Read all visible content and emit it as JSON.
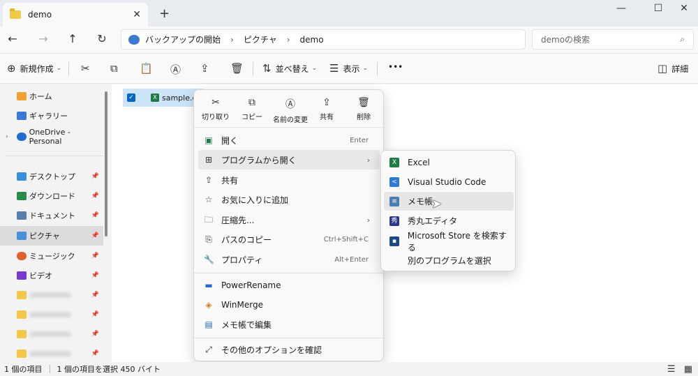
{
  "window": {
    "tab_title": "demo",
    "tab_close": "✕",
    "new_tab": "+",
    "minimize": "—",
    "maximize": "☐",
    "close": "✕"
  },
  "nav": {
    "back": "←",
    "forward": "→",
    "up": "↑",
    "refresh": "↻",
    "breadcrumbs": [
      "バックアップの開始",
      "ピクチャ",
      "demo"
    ],
    "breadcrumb_sep": "›",
    "search_placeholder": "demoの検索",
    "search_icon": "⌕"
  },
  "toolbar": {
    "new_label": "新規作成",
    "new_icon": "⊕",
    "cut_icon": "✂",
    "copy_icon": "⧉",
    "paste_icon": "📋",
    "rename_icon": "Ⓐ",
    "share_icon": "⇪",
    "delete_icon": "🗑",
    "sort_label": "並べ替え",
    "sort_icon": "⇅",
    "view_label": "表示",
    "view_icon": "☰",
    "more": "•••",
    "details_label": "詳細",
    "details_icon": "◫",
    "chevron": "⌄"
  },
  "sidebar": {
    "items": [
      {
        "label": "ホーム",
        "color": "#f0a030"
      },
      {
        "label": "ギャラリー",
        "color": "#3a78d4"
      },
      {
        "label": "OneDrive - Personal",
        "color": "#1f6fd0"
      },
      {
        "label": "デスクトップ",
        "color": "#3a8fdc"
      },
      {
        "label": "ダウンロード",
        "color": "#2a8a4a"
      },
      {
        "label": "ドキュメント",
        "color": "#5a7fa8"
      },
      {
        "label": "ピクチャ",
        "color": "#4a90d9"
      },
      {
        "label": "ミュージック",
        "color": "#e06030"
      },
      {
        "label": "ビデオ",
        "color": "#7a3ad0"
      }
    ],
    "pin": "📌",
    "expand": "›"
  },
  "file": {
    "name": "sample.c",
    "check": "✓",
    "icon_text": "X"
  },
  "context_menu": {
    "top_actions": [
      {
        "label": "切り取り",
        "icon": "✂"
      },
      {
        "label": "コピー",
        "icon": "⧉"
      },
      {
        "label": "名前の変更",
        "icon": "Ⓐ"
      },
      {
        "label": "共有",
        "icon": "⇪"
      },
      {
        "label": "削除",
        "icon": "🗑"
      }
    ],
    "items": [
      {
        "label": "開く",
        "shortcut": "Enter",
        "icon": "▣"
      },
      {
        "label": "プログラムから開く",
        "shortcut": "",
        "icon": "⊞"
      },
      {
        "label": "共有",
        "shortcut": "",
        "icon": "⇪"
      },
      {
        "label": "お気に入りに追加",
        "shortcut": "",
        "icon": "☆"
      },
      {
        "label": "圧縮先...",
        "shortcut": "",
        "icon": "🗀"
      },
      {
        "label": "パスのコピー",
        "shortcut": "Ctrl+Shift+C",
        "icon": "⎘"
      },
      {
        "label": "プロパティ",
        "shortcut": "Alt+Enter",
        "icon": "🔧"
      },
      {
        "label": "PowerRename",
        "shortcut": "",
        "icon": "▬"
      },
      {
        "label": "WinMerge",
        "shortcut": "",
        "icon": "◈"
      },
      {
        "label": "メモ帳で編集",
        "shortcut": "",
        "icon": "▤"
      },
      {
        "label": "その他のオプションを確認",
        "shortcut": "",
        "icon": "⤢"
      }
    ],
    "arrow": "›"
  },
  "submenu": {
    "items": [
      {
        "label": "Excel",
        "icon_color": "#1f7a45",
        "icon_text": "X"
      },
      {
        "label": "Visual Studio Code",
        "icon_color": "#2a7ad6",
        "icon_text": "<"
      },
      {
        "label": "メモ帳",
        "icon_color": "#4a7fb0",
        "icon_text": "≡"
      },
      {
        "label": "秀丸エディタ",
        "icon_color": "#2a3a8a",
        "icon_text": "秀"
      },
      {
        "label": "Microsoft Store を検索する",
        "icon_color": "#1a4a8a",
        "icon_text": "▪"
      },
      {
        "label": "別のプログラムを選択",
        "icon_color": "",
        "icon_text": ""
      }
    ],
    "cursor": "➤"
  },
  "status": {
    "item_count": "1 個の項目",
    "selection": "1 個の項目を選択  450 バイト",
    "view_list": "☰",
    "view_tiles": "▦"
  }
}
